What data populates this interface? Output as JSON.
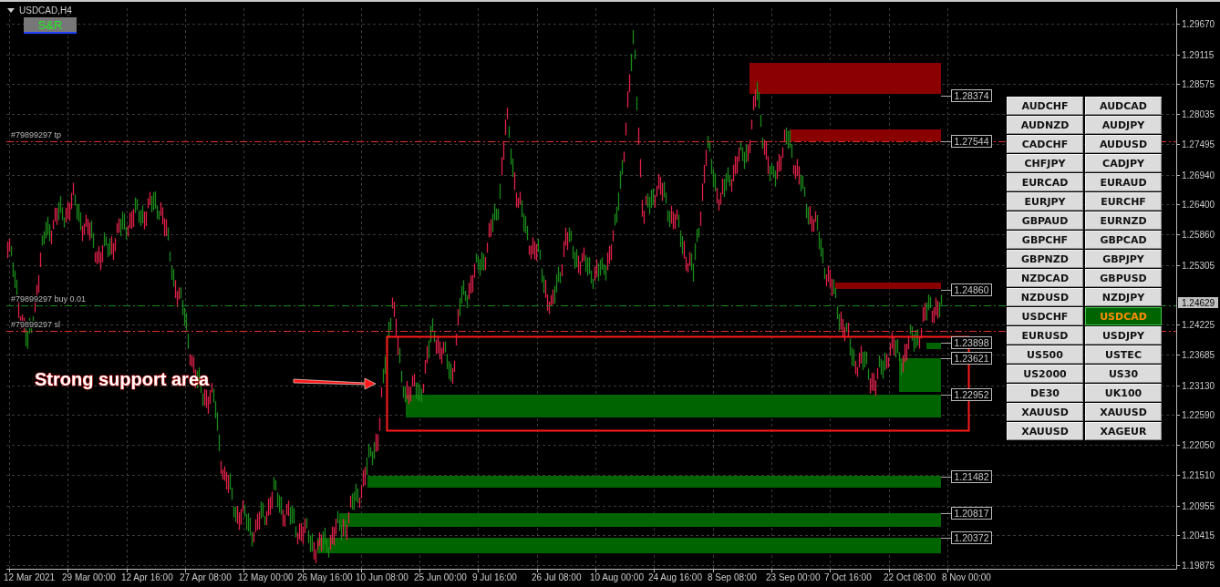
{
  "chart": {
    "title": "USDCAD,H4",
    "indicator_button": "S&R"
  },
  "trade_lines": [
    {
      "kind": "tp",
      "label": "#79899297 tp"
    },
    {
      "kind": "buy",
      "label": "#79899297 buy 0.01"
    },
    {
      "kind": "sl",
      "label": "#79899297 sl"
    }
  ],
  "zones": [
    {
      "kind": "resistance",
      "label": "1.28374"
    },
    {
      "kind": "resistance",
      "label": "1.27544"
    },
    {
      "kind": "resistance",
      "label": "1.24860"
    },
    {
      "kind": "support",
      "label": "1.23898"
    },
    {
      "kind": "support",
      "label": "1.23621"
    },
    {
      "kind": "support",
      "label": "1.22952"
    },
    {
      "kind": "support",
      "label": "1.21482"
    },
    {
      "kind": "support",
      "label": "1.20817"
    },
    {
      "kind": "support",
      "label": "1.20372"
    }
  ],
  "annotation": {
    "text": "Strong support area"
  },
  "symbols": [
    {
      "label": "AUDCHF",
      "selected": false
    },
    {
      "label": "AUDCAD",
      "selected": false
    },
    {
      "label": "AUDNZD",
      "selected": false
    },
    {
      "label": "AUDJPY",
      "selected": false
    },
    {
      "label": "CADCHF",
      "selected": false
    },
    {
      "label": "AUDUSD",
      "selected": false
    },
    {
      "label": "CHFJPY",
      "selected": false
    },
    {
      "label": "CADJPY",
      "selected": false
    },
    {
      "label": "EURCAD",
      "selected": false
    },
    {
      "label": "EURAUD",
      "selected": false
    },
    {
      "label": "EURJPY",
      "selected": false
    },
    {
      "label": "EURCHF",
      "selected": false
    },
    {
      "label": "GBPAUD",
      "selected": false
    },
    {
      "label": "EURNZD",
      "selected": false
    },
    {
      "label": "GBPCHF",
      "selected": false
    },
    {
      "label": "GBPCAD",
      "selected": false
    },
    {
      "label": "GBPNZD",
      "selected": false
    },
    {
      "label": "GBPJPY",
      "selected": false
    },
    {
      "label": "NZDCAD",
      "selected": false
    },
    {
      "label": "GBPUSD",
      "selected": false
    },
    {
      "label": "NZDUSD",
      "selected": false
    },
    {
      "label": "NZDJPY",
      "selected": false
    },
    {
      "label": "USDCHF",
      "selected": false
    },
    {
      "label": "USDCAD",
      "selected": true
    },
    {
      "label": "EURUSD",
      "selected": false
    },
    {
      "label": "USDJPY",
      "selected": false
    },
    {
      "label": "US500",
      "selected": false
    },
    {
      "label": "USTEC",
      "selected": false
    },
    {
      "label": "US2000",
      "selected": false
    },
    {
      "label": "US30",
      "selected": false
    },
    {
      "label": "DE30",
      "selected": false
    },
    {
      "label": "UK100",
      "selected": false
    },
    {
      "label": "XAUUSD",
      "selected": false
    },
    {
      "label": "XAUUSD",
      "selected": false
    },
    {
      "label": "XAUUSD",
      "selected": false
    },
    {
      "label": "XAGEUR",
      "selected": false
    }
  ],
  "price_axis": {
    "ticks": [
      "1.29670",
      "1.29115",
      "1.28575",
      "1.28035",
      "1.27495",
      "1.26940",
      "1.26400",
      "1.25860",
      "1.25305",
      "1.24225",
      "1.23685",
      "1.23130",
      "1.22590",
      "1.22050",
      "1.21510",
      "1.20955",
      "1.20415",
      "1.19875"
    ],
    "current_price": "1.24629"
  },
  "time_axis": {
    "ticks": [
      "12 Mar 2021",
      "29 Mar 00:00",
      "12 Apr 16:00",
      "27 Apr 08:00",
      "12 May 00:00",
      "26 May 16:00",
      "10 Jun 08:00",
      "25 Jun 00:00",
      "9 Jul 16:00",
      "26 Jul 08:00",
      "10 Aug 00:00",
      "24 Aug 16:00",
      "8 Sep 08:00",
      "23 Sep 00:00",
      "7 Oct 16:00",
      "22 Oct 08:00",
      "8 Nov 00:00"
    ]
  }
}
